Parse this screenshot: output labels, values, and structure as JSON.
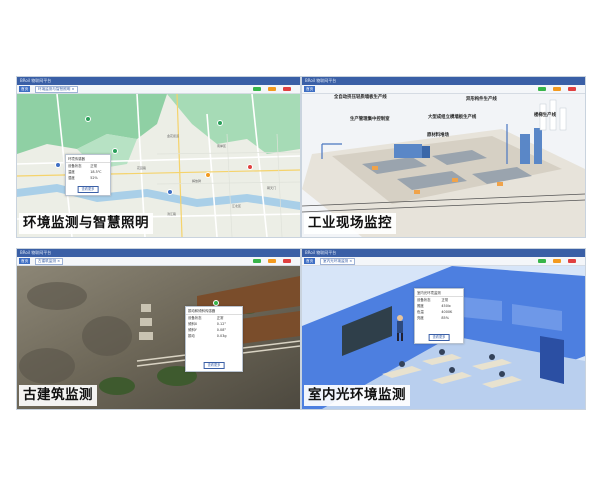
{
  "app_title": "BRoil 物联网平台",
  "panels": [
    {
      "caption": "环境监测与智慧照明",
      "home_tab": "首页",
      "active_tab": "环境监测与智慧照明 ×",
      "popup": {
        "title": "环境传感器",
        "rows": [
          {
            "label": "设备状态",
            "value": "正常"
          },
          {
            "label": "温度",
            "value": "18.5℃"
          },
          {
            "label": "湿度",
            "value": "52%"
          },
          {
            "label": "光照",
            "value": "320lx"
          }
        ],
        "button": "查看更多"
      },
      "map_labels": [
        "金花街道",
        "南岸区",
        "花园路",
        "解放碑",
        "朝天门",
        "江北区",
        "滨江路"
      ]
    },
    {
      "caption": "工业现场监控",
      "home_tab": "首页",
      "active_tab": "工业现场监控 ×",
      "labels": [
        "全自动挤压轻质墙板生产线",
        "生产管理集中控制室",
        "原材料堆场",
        "大型成组立模墙板生产线",
        "异形构件生产线",
        "楼梯生产线"
      ]
    },
    {
      "caption": "古建筑监测",
      "home_tab": "首页",
      "active_tab": "古建筑监测 ×",
      "popup": {
        "title": "振动和倾斜传感器",
        "rows": [
          {
            "label": "设备状态",
            "value": "正常"
          },
          {
            "label": "倾斜X",
            "value": "0.12°"
          },
          {
            "label": "倾斜Y",
            "value": "0.08°"
          },
          {
            "label": "振动",
            "value": "0.03g"
          }
        ],
        "button": "查看更多"
      }
    },
    {
      "caption": "室内光环境监测",
      "home_tab": "首页",
      "active_tab": "室内光环境监测 ×",
      "popup": {
        "title": "室内光环境监测",
        "rows": [
          {
            "label": "设备状态",
            "value": "正常"
          },
          {
            "label": "照度",
            "value": "450lx"
          },
          {
            "label": "色温",
            "value": "4000K"
          },
          {
            "label": "亮度",
            "value": "85%"
          }
        ],
        "button": "查看更多"
      }
    }
  ],
  "status_legend": [
    "在线",
    "离线",
    "告警"
  ],
  "colors": {
    "header": "#3a5fa6",
    "accent": "#3f6fc4",
    "online": "#38b54a",
    "warning": "#f39a1e",
    "alarm": "#e04040",
    "map_green": "#7fc89a",
    "room_blue": "#4d7fe0"
  }
}
